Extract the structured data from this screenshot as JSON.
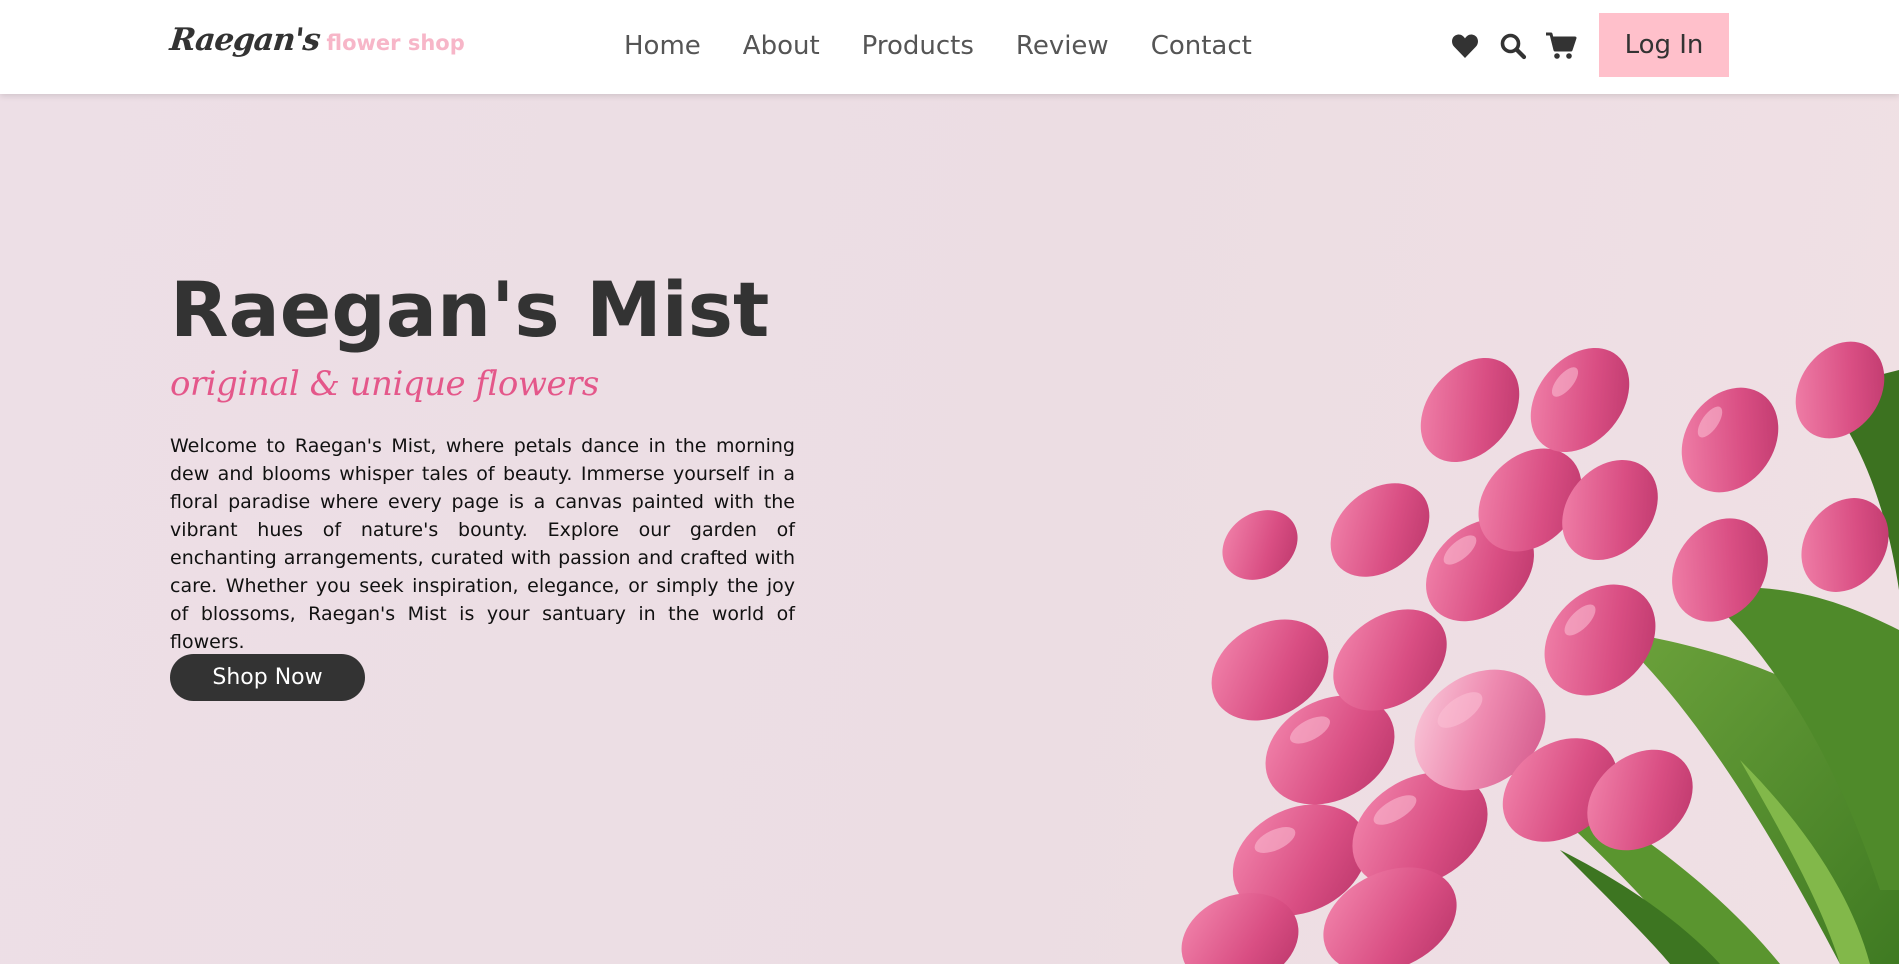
{
  "header": {
    "logo_script": "Raegan's",
    "logo_sub": "flower shop",
    "nav": [
      "Home",
      "About",
      "Products",
      "Review",
      "Contact"
    ],
    "icons": [
      "heart-icon",
      "search-icon",
      "cart-icon"
    ],
    "login_label": "Log In"
  },
  "hero": {
    "title": "Raegan's Mist",
    "tagline": "original & unique flowers",
    "description": "Welcome to Raegan's Mist, where petals dance in the morning dew and blooms whisper tales of beauty. Immerse yourself in a floral paradise where every page is a canvas painted with the vibrant hues of nature's bounty. Explore our garden of enchanting arrangements, curated with passion and crafted with care. Whether you seek inspiration, elegance, or simply the joy of blossoms, Raegan's Mist is your santuary in the world of flowers.",
    "cta_label": "Shop Now"
  },
  "colors": {
    "accent": "#ffc0cb",
    "tagline": "#e4578a",
    "dark": "#333333",
    "background": "#ecdde3"
  }
}
